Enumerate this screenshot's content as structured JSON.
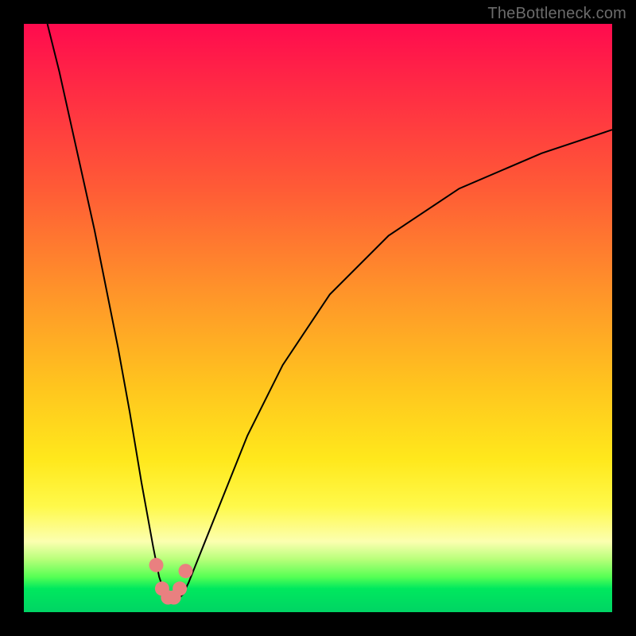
{
  "watermark": "TheBottleneck.com",
  "chart_data": {
    "type": "line",
    "title": "",
    "xlabel": "",
    "ylabel": "",
    "xlim": [
      0,
      100
    ],
    "ylim": [
      0,
      100
    ],
    "series": [
      {
        "name": "bottleneck-curve",
        "x": [
          4,
          6,
          8,
          10,
          12,
          14,
          16,
          18,
          20,
          22,
          23,
          24,
          25,
          26,
          27,
          28,
          30,
          34,
          38,
          44,
          52,
          62,
          74,
          88,
          100
        ],
        "values": [
          100,
          92,
          83,
          74,
          65,
          55,
          45,
          34,
          22,
          11,
          6,
          3,
          2,
          2,
          3,
          5,
          10,
          20,
          30,
          42,
          54,
          64,
          72,
          78,
          82
        ]
      }
    ],
    "markers": {
      "name": "highlight-dots",
      "x": [
        22.5,
        23.5,
        24.5,
        25.5,
        26.5,
        27.5
      ],
      "values": [
        8,
        4,
        2.5,
        2.5,
        4,
        7
      ]
    },
    "background_gradient": {
      "stops": [
        {
          "pos": 0.0,
          "color": "#ff0b4e"
        },
        {
          "pos": 0.28,
          "color": "#ff5b36"
        },
        {
          "pos": 0.62,
          "color": "#ffc61e"
        },
        {
          "pos": 0.88,
          "color": "#fcffb0"
        },
        {
          "pos": 0.94,
          "color": "#57ff54"
        },
        {
          "pos": 1.0,
          "color": "#00d464"
        }
      ]
    }
  }
}
